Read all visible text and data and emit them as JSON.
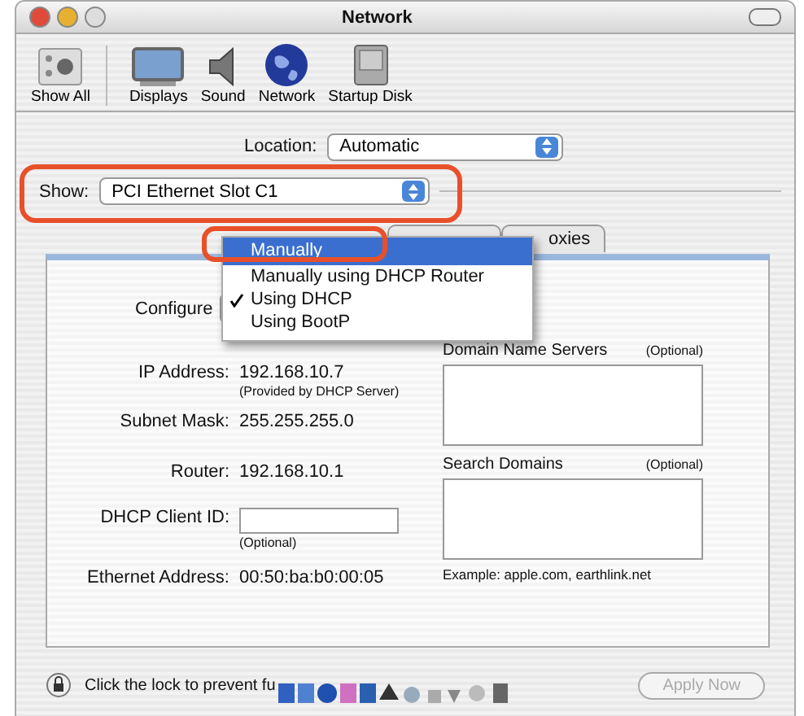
{
  "window": {
    "title": "Network"
  },
  "toolbar": [
    {
      "label": "Show All",
      "kind": "showall"
    },
    {
      "label": "Displays",
      "kind": "display"
    },
    {
      "label": "Sound",
      "kind": "sound"
    },
    {
      "label": "Network",
      "kind": "globe"
    },
    {
      "label": "Startup Disk",
      "kind": "disk"
    }
  ],
  "location": {
    "label": "Location:",
    "value": "Automatic"
  },
  "show": {
    "label": "Show:",
    "value": "PCI Ethernet Slot C1"
  },
  "tabs": [
    {
      "label": "oxies",
      "selected": false
    }
  ],
  "configure": {
    "label": "Configure",
    "menu": [
      {
        "label": "Manually",
        "selected": true,
        "checked": false
      },
      {
        "label": "Manually using DHCP Router",
        "selected": false,
        "checked": false
      },
      {
        "label": "Using DHCP",
        "selected": false,
        "checked": true
      },
      {
        "label": "Using BootP",
        "selected": false,
        "checked": false
      }
    ]
  },
  "fields": [
    {
      "kind": "text",
      "label": "IP Address:",
      "value": "192.168.10.7",
      "note": "(Provided by DHCP Server)"
    },
    {
      "kind": "text",
      "label": "Subnet Mask:",
      "value": "255.255.255.0"
    },
    {
      "kind": "text",
      "label": "Router:",
      "value": "192.168.10.1"
    },
    {
      "kind": "input",
      "label": "DHCP Client ID:",
      "note": "(Optional)"
    },
    {
      "kind": "text",
      "label": "Ethernet Address:",
      "value": "00:50:ba:b0:00:05"
    }
  ],
  "dns": {
    "label": "Domain Name Servers",
    "note": "(Optional)"
  },
  "search_domains": {
    "label": "Search Domains",
    "note": "(Optional)",
    "example": "Example: apple.com, earthlink.net"
  },
  "footer": {
    "lock_text": "Click the lock to prevent fu",
    "button": "Apply Now",
    "button_disabled": true
  }
}
